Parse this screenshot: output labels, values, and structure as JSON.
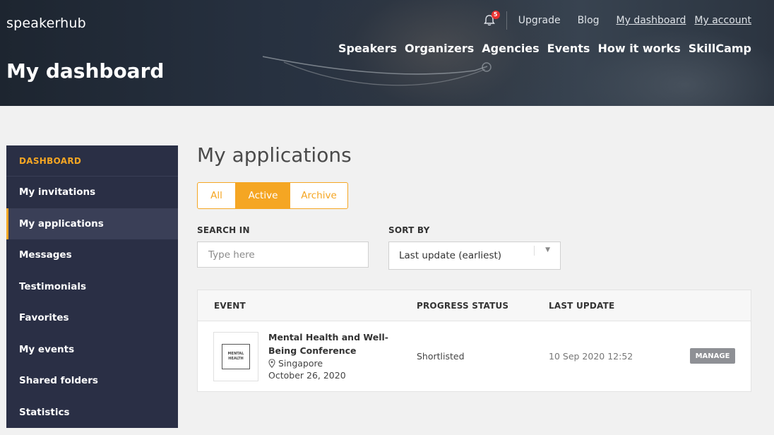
{
  "brand": {
    "logo_text": "speakerhub"
  },
  "header": {
    "page_title": "My dashboard",
    "notification_count": "5",
    "top_links": [
      "Upgrade",
      "Blog",
      "My dashboard",
      "My account"
    ],
    "main_nav": [
      "Speakers",
      "Organizers",
      "Agencies",
      "Events",
      "How it works",
      "SkillCamp"
    ]
  },
  "sidebar": {
    "heading": "DASHBOARD",
    "items": [
      {
        "label": "My invitations"
      },
      {
        "label": "My applications",
        "active": true
      },
      {
        "label": "Messages"
      },
      {
        "label": "Testimonials"
      },
      {
        "label": "Favorites"
      },
      {
        "label": "My events"
      },
      {
        "label": "Shared folders"
      },
      {
        "label": "Statistics"
      }
    ]
  },
  "main": {
    "title": "My applications",
    "tabs": [
      "All",
      "Active",
      "Archive"
    ],
    "active_tab": "Active",
    "search": {
      "label": "SEARCH IN",
      "placeholder": "Type here",
      "value": ""
    },
    "sort": {
      "label": "SORT BY",
      "value": "Last update (earliest)"
    },
    "table": {
      "headers": [
        "EVENT",
        "PROGRESS STATUS",
        "LAST UPDATE"
      ],
      "rows": [
        {
          "thumb_text": [
            "MENTAL",
            "HEALTH"
          ],
          "title": "Mental Health and Well-Being Conference",
          "location": "Singapore",
          "date": "October 26, 2020",
          "status": "Shortlisted",
          "last_update": "10 Sep 2020 12:52",
          "action": "MANAGE"
        }
      ]
    }
  },
  "colors": {
    "accent": "#f5a623",
    "sidebar_bg": "#2a2f45",
    "badge": "#e8312f"
  },
  "icons": {
    "bell": "bell-icon",
    "location": "map-pin-icon",
    "caret": "caret-down-icon"
  }
}
